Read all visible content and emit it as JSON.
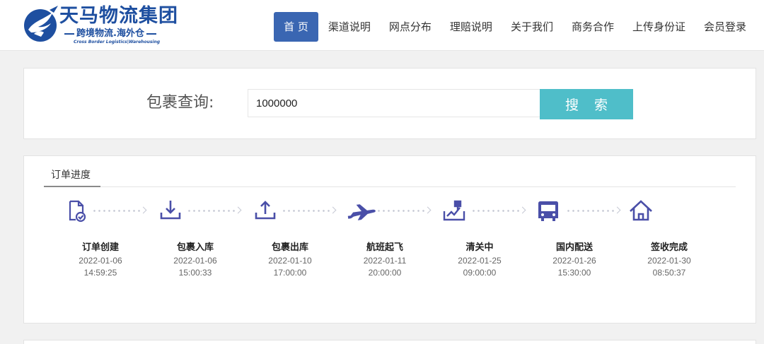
{
  "brand": {
    "title": "天马物流集团",
    "subtitle": "跨境物流.海外仓",
    "subtitle_en": "Cross Border Logistics|Warehousing",
    "color": "#1e4fa0"
  },
  "nav": {
    "items": [
      {
        "label": "首 页",
        "active": true
      },
      {
        "label": "渠道说明"
      },
      {
        "label": "网点分布"
      },
      {
        "label": "理赔说明"
      },
      {
        "label": "关于我们"
      },
      {
        "label": "商务合作"
      },
      {
        "label": "上传身份证"
      },
      {
        "label": "会员登录"
      }
    ],
    "active_color": "#3a66b2"
  },
  "search": {
    "label": "包裹查询:",
    "value": "1000000",
    "button_label": "搜 索",
    "button_color": "#4fbec9"
  },
  "progress": {
    "tab_label": "订单进度",
    "icon_color": "#4a4fa8",
    "steps": [
      {
        "icon": "document-check-icon",
        "name": "订单创建",
        "date": "2022-01-06",
        "time": "14:59:25"
      },
      {
        "icon": "inbound-download-icon",
        "name": "包裹入库",
        "date": "2022-01-06",
        "time": "15:00:33"
      },
      {
        "icon": "outbound-upload-icon",
        "name": "包裹出库",
        "date": "2022-01-10",
        "time": "17:00:00"
      },
      {
        "icon": "airplane-icon",
        "name": "航班起飞",
        "date": "2022-01-11",
        "time": "20:00:00"
      },
      {
        "icon": "customs-clearance-icon",
        "name": "清关中",
        "date": "2022-01-25",
        "time": "09:00:00"
      },
      {
        "icon": "bus-icon",
        "name": "国内配送",
        "date": "2022-01-26",
        "time": "15:30:00"
      },
      {
        "icon": "house-icon",
        "name": "签收完成",
        "date": "2022-01-30",
        "time": "08:50:37"
      }
    ]
  }
}
